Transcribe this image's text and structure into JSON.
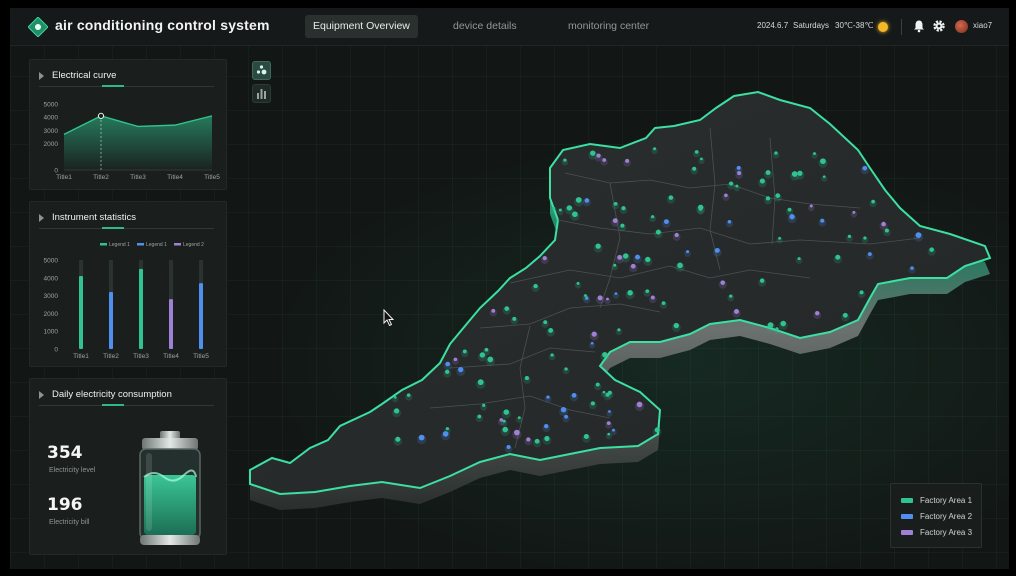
{
  "header": {
    "app_title": "air conditioning control system",
    "tabs": [
      {
        "label": "Equipment Overview",
        "active": true
      },
      {
        "label": "device details",
        "active": false
      },
      {
        "label": "monitoring center",
        "active": false
      }
    ],
    "date": "2024.6.7",
    "weekday": "Saturdays",
    "temperature": "30℃-38℃",
    "username": "xiao7",
    "icons": [
      "logo-icon",
      "sun-icon",
      "bell-icon",
      "gear-icon",
      "avatar"
    ]
  },
  "panels": {
    "electrical_curve": {
      "title": "Electrical curve"
    },
    "instrument_statistics": {
      "title": "Instrument statistics"
    },
    "daily_consumption": {
      "title": "Daily electricity consumption",
      "level_value": "354",
      "level_label": "Electricity level",
      "bill_value": "196",
      "bill_label": "Electricity bill"
    }
  },
  "colors": {
    "accent": "#2fc48f",
    "blue": "#4e8ff0",
    "purple": "#a07fd6",
    "background": "#121614"
  },
  "chart_data": [
    {
      "type": "area",
      "title": "Electrical curve",
      "categories": [
        "Title1",
        "Title2",
        "Title3",
        "Title4",
        "Title5"
      ],
      "values": [
        2700,
        4100,
        3300,
        3400,
        4100
      ],
      "ylim": [
        0,
        5000
      ],
      "yticks": [
        0,
        2000,
        3000,
        4000,
        5000
      ],
      "highlighted_index": 1
    },
    {
      "type": "bar",
      "title": "Instrument statistics",
      "categories": [
        "Title1",
        "Title2",
        "Title3",
        "Title4",
        "Title5"
      ],
      "legend": [
        {
          "name": "Legend 1",
          "color": "#2fc48f"
        },
        {
          "name": "Legend 1",
          "color": "#4e8ff0"
        },
        {
          "name": "Legend 2",
          "color": "#a07fd6"
        }
      ],
      "values": [
        4100,
        3200,
        4500,
        2800,
        3700
      ],
      "bar_colors": [
        "#2fc48f",
        "#4e8ff0",
        "#2fc48f",
        "#a07fd6",
        "#4e8ff0"
      ],
      "ylim": [
        0,
        5000
      ],
      "yticks": [
        0,
        1000,
        2000,
        3000,
        4000,
        5000
      ],
      "legend_placement": "top"
    }
  ],
  "map": {
    "tools": [
      "cluster-view-icon",
      "bar-chart-icon"
    ],
    "legend": [
      {
        "label": "Factory Area 1",
        "color": "#2fc48f"
      },
      {
        "label": "Factory Area 2",
        "color": "#4e8ff0"
      },
      {
        "label": "Factory Area 3",
        "color": "#a07fd6"
      }
    ]
  }
}
